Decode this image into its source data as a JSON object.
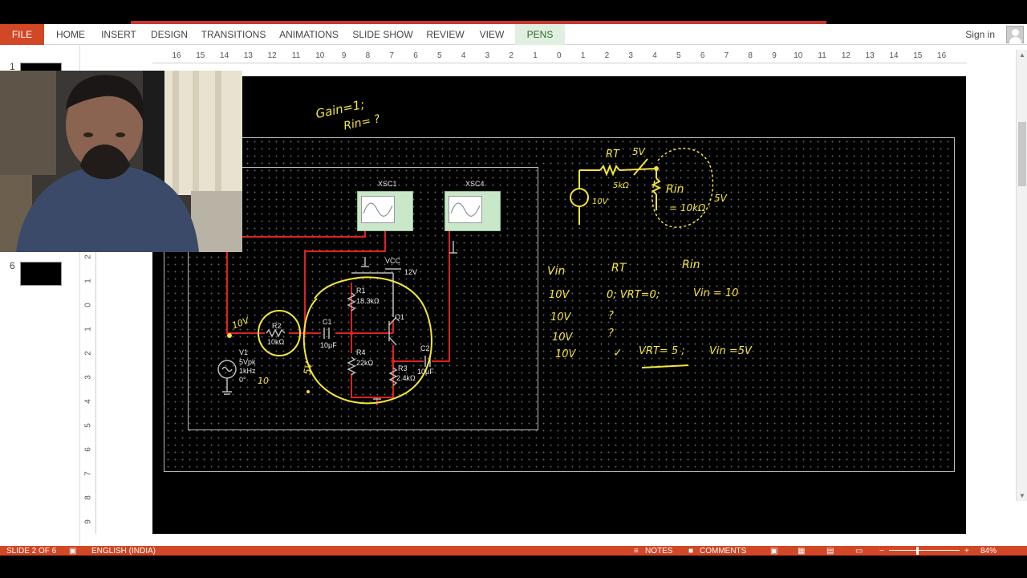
{
  "ribbon": {
    "tabs": [
      "FILE",
      "HOME",
      "INSERT",
      "DESIGN",
      "TRANSITIONS",
      "ANIMATIONS",
      "SLIDE SHOW",
      "REVIEW",
      "VIEW",
      "PENS"
    ],
    "signin": "Sign in"
  },
  "thumbnails": {
    "first_num": "1",
    "second_num": "6"
  },
  "ruler": {
    "top": [
      "16",
      "15",
      "14",
      "13",
      "12",
      "11",
      "10",
      "9",
      "8",
      "7",
      "6",
      "5",
      "4",
      "3",
      "2",
      "1",
      "0",
      "1",
      "2",
      "3",
      "4",
      "5",
      "6",
      "7",
      "8",
      "9",
      "10",
      "11",
      "12",
      "13",
      "14",
      "15",
      "16"
    ],
    "left": [
      "2",
      "1",
      "0",
      "1",
      "2",
      "3",
      "4",
      "5",
      "6",
      "7",
      "8",
      "9"
    ]
  },
  "circuit": {
    "xsc1": "XSC1",
    "xsc4": "XSC4",
    "vcc": "VCC",
    "vcc_val": "12V",
    "r1": "R1",
    "r1_val": "18.3kΩ",
    "r4": "R4",
    "r4_val": "22kΩ",
    "r3": "R3",
    "r3_val": "2.4kΩ",
    "r2": "R2",
    "r2_val": "10kΩ",
    "c1": "C1",
    "c1_val": "10µF",
    "c2": "C2",
    "c2_val": "10µF",
    "q1": "Q1",
    "v1": "V1",
    "v1_amp": "5Vpk",
    "v1_freq": "1kHz",
    "v1_phase": "0°"
  },
  "annotations": {
    "gain": "Gain=1;",
    "rin_q": "Rin= ?",
    "rt": "RT",
    "five_v": "5V",
    "five_k": "5kΩ",
    "rin_lbl": "Rin",
    "ten_v": "10V",
    "ten_k": "= 10kΩ",
    "five_v2": "5V",
    "col_vin": "Vin",
    "col_rt": "RT",
    "col_rin": "Rin",
    "r1c1": "10V",
    "r1c2": "0; VRT=0;",
    "r1c3": "Vin = 10",
    "r2c1": "10V",
    "r2c2": "?",
    "r3c1": "10V",
    "r3c2": "?",
    "r4c1": "10V",
    "r4c2": "✓",
    "r4c3": "VRT= 5 ;",
    "r4c4": "Vin =5V",
    "node_10v": "10V",
    "node_5v": "5V",
    "src_10": "10"
  },
  "status": {
    "slide": "SLIDE 2 OF 6",
    "lang": "ENGLISH (INDIA)",
    "notes": "NOTES",
    "comments": "COMMENTS",
    "zoom": "84%"
  },
  "colors": {
    "accent": "#d24726",
    "wire": "#e02020",
    "ink": "#f5e63a",
    "grid": "#5f5f5f"
  }
}
